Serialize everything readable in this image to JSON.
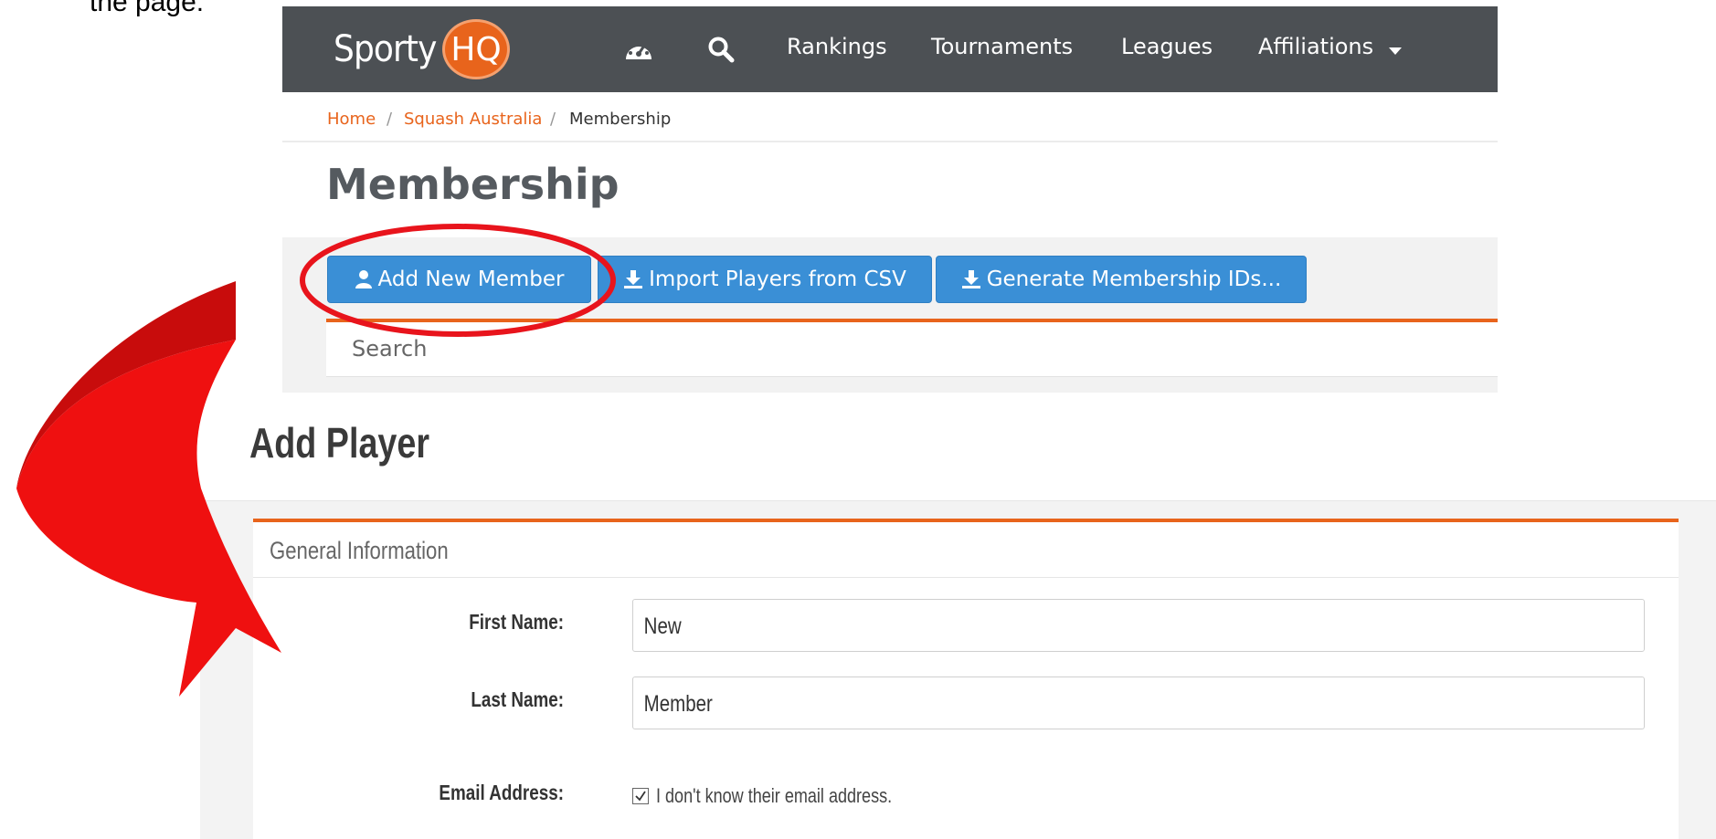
{
  "caption_fragment": "the page.",
  "navbar": {
    "brand_text": "Sporty",
    "brand_badge": "HQ",
    "icons": [
      "dashboard-icon",
      "search-icon"
    ],
    "links": [
      "Rankings",
      "Tournaments",
      "Leagues",
      "Affiliations"
    ],
    "dropdown_icon": "caret-down-icon",
    "background": "#4c5054"
  },
  "breadcrumb": {
    "items": [
      "Home",
      "Squash Australia",
      "Membership"
    ],
    "separator": "/"
  },
  "membership_page": {
    "title": "Membership",
    "buttons": [
      {
        "label": "Add New Member",
        "icon": "user-icon"
      },
      {
        "label": "Import Players from CSV",
        "icon": "download-icon"
      },
      {
        "label": "Generate Membership IDs...",
        "icon": "download-icon"
      }
    ],
    "search_placeholder": "Search"
  },
  "add_player": {
    "title": "Add Player",
    "panel_title": "General Information",
    "fields": [
      {
        "label": "First Name:",
        "value": "New"
      },
      {
        "label": "Last Name:",
        "value": "Member"
      },
      {
        "label": "Email Address:",
        "checkbox_checked": true,
        "checkbox_label": "I don't know their email address."
      }
    ]
  },
  "colors": {
    "accent_orange": "#e8641c",
    "button_blue": "#3a8fd6",
    "highlight_red": "#e8141c"
  }
}
